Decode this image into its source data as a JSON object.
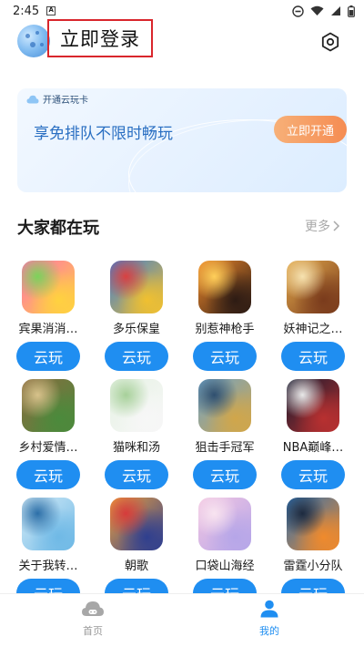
{
  "status_bar": {
    "time": "2:45",
    "badge": "A"
  },
  "header": {
    "login_label": "立即登录"
  },
  "banner": {
    "tag": "开通云玩卡",
    "text": "享免排队不限时畅玩",
    "button": "立即开通"
  },
  "section": {
    "title": "大家都在玩",
    "more": "更多"
  },
  "play_label": "云玩",
  "games": [
    {
      "name": "宾果消消…",
      "colors": [
        "#ff6fb1",
        "#ffd23f",
        "#7bd35a"
      ]
    },
    {
      "name": "多乐保皇",
      "colors": [
        "#3a7bd5",
        "#f0c030",
        "#d94141"
      ]
    },
    {
      "name": "别惹神枪手",
      "colors": [
        "#f08a2c",
        "#2d1b14",
        "#ffcf5a"
      ]
    },
    {
      "name": "妖神记之…",
      "colors": [
        "#e2a94c",
        "#7a3b1c",
        "#f6e2b0"
      ]
    },
    {
      "name": "乡村爱情…",
      "colors": [
        "#8a6b3f",
        "#4b8a3c",
        "#d7c28b"
      ]
    },
    {
      "name": "猫咪和汤",
      "colors": [
        "#e6f2e4",
        "#f7f7f7",
        "#a7d09a"
      ]
    },
    {
      "name": "狙击手冠军",
      "colors": [
        "#6ea3c9",
        "#d1a64a",
        "#2f4f6f"
      ]
    },
    {
      "name": "NBA巅峰…",
      "colors": [
        "#141a2e",
        "#b83030",
        "#e9e9e9"
      ]
    },
    {
      "name": "关于我转…",
      "colors": [
        "#d6ecf7",
        "#6fb9e6",
        "#2c6fa8"
      ]
    },
    {
      "name": "朝歌",
      "colors": [
        "#f0a23c",
        "#2f3f8f",
        "#d63b3b"
      ]
    },
    {
      "name": "口袋山海经",
      "colors": [
        "#f3c6e2",
        "#b6a6e8",
        "#f8e4f0"
      ]
    },
    {
      "name": "雷霆小分队",
      "colors": [
        "#2c6fb0",
        "#f08a2c",
        "#1d2a3f"
      ]
    }
  ],
  "tabs": [
    {
      "label": "首页",
      "icon": "cloud-gamepad-icon",
      "active": false
    },
    {
      "label": "我的",
      "icon": "person-icon",
      "active": true
    }
  ],
  "accent_color": "#1f8ef1",
  "login_box_color": "#d9262c"
}
